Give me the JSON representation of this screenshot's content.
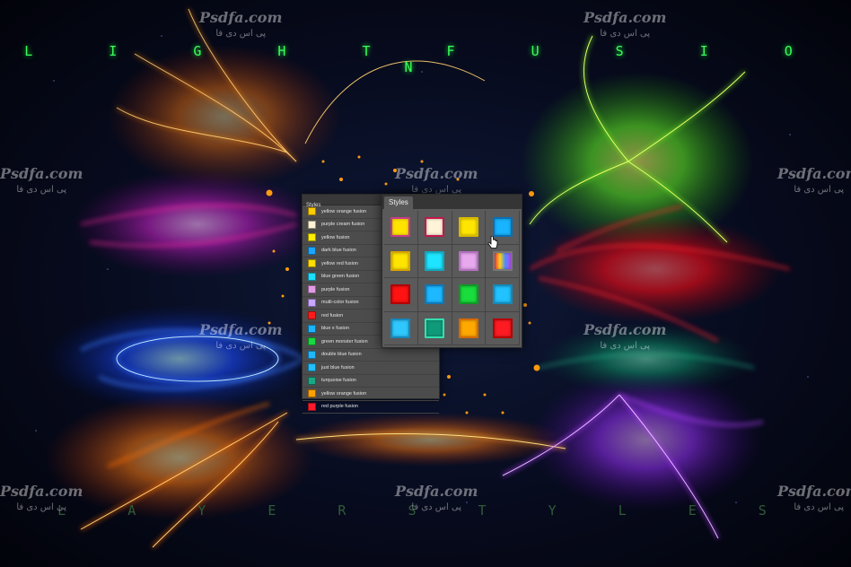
{
  "headline": "L I G H T   F U S I O N",
  "subline": "L A Y E R   S T Y L E S",
  "watermark": {
    "latin": "Psdfa.com",
    "farsi": "پی اس دی فا"
  },
  "list_panel": {
    "title": "Styles",
    "items": [
      {
        "label": "yellow orange fusion",
        "color": "#ffcc00"
      },
      {
        "label": "purple cream fusion",
        "color": "#fff3d6"
      },
      {
        "label": "yellow fusion",
        "color": "#ffee00"
      },
      {
        "label": "dark blue fusion",
        "color": "#1aa6ff"
      },
      {
        "label": "yellow red fusion",
        "color": "#ffdd00"
      },
      {
        "label": "blue green fusion",
        "color": "#19e0ff"
      },
      {
        "label": "purple fusion",
        "color": "#e39be6"
      },
      {
        "label": "mutli-color fusion",
        "color": "#c9a6ff"
      },
      {
        "label": "red fusion",
        "color": "#ff1a1a"
      },
      {
        "label": "blue x fusion",
        "color": "#1ab5ff"
      },
      {
        "label": "green monster fusion",
        "color": "#19d840"
      },
      {
        "label": "double blue fusion",
        "color": "#20b7ff"
      },
      {
        "label": "just blue fusion",
        "color": "#20c0ff"
      },
      {
        "label": "turquoise fusion",
        "color": "#1aa884"
      },
      {
        "label": "yellow orange fusion",
        "color": "#ffa000"
      },
      {
        "label": "red purple fusion",
        "color": "#ff1a2a"
      }
    ]
  },
  "styles_panel": {
    "tab": "Styles",
    "tiles": [
      {
        "color": "#ffe400",
        "border": "#c83a8a"
      },
      {
        "color": "#fff4d9",
        "border": "#c2184e"
      },
      {
        "color": "#ffe600",
        "border": "#d9b800"
      },
      {
        "color": "#18b4ff",
        "border": "#0b6fb3"
      },
      {
        "color": "#ffe400",
        "border": "#d9a400"
      },
      {
        "color": "#1ee5ff",
        "border": "#10a8c0"
      },
      {
        "color": "#e7a8ee",
        "border": "#b46fc0"
      },
      {
        "color": "multicolor",
        "border": "#777777"
      },
      {
        "color": "#ff1212",
        "border": "#b30000"
      },
      {
        "color": "#1db8ff",
        "border": "#0f78b8"
      },
      {
        "color": "#19dd3c",
        "border": "#0f9a26"
      },
      {
        "color": "#20c2ff",
        "border": "#138ab8"
      },
      {
        "color": "#2ec8ff",
        "border": "#1688bb"
      },
      {
        "color": "#0f9a7a",
        "border": "#33e0b0"
      },
      {
        "color": "#ffa800",
        "border": "#d66a00"
      },
      {
        "color": "#ff1b22",
        "border": "#b80000"
      }
    ]
  }
}
